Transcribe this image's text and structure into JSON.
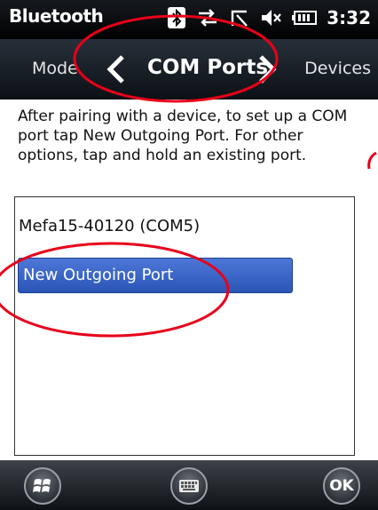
{
  "statusbar": {
    "app_title": "Bluetooth",
    "time": "3:32",
    "icons": [
      "bluetooth-icon",
      "sync-arrows-icon",
      "signal-off-icon",
      "volume-mute-icon",
      "battery-icon"
    ]
  },
  "navbar": {
    "prev_label": "Mode",
    "current_label": "COM Ports",
    "next_label": "Devices"
  },
  "instructions": "After pairing with a device, to set up a COM port tap New Outgoing Port. For other options, tap and hold an existing port.",
  "ports": {
    "items": [
      {
        "label": "Mefa15-40120 (COM5)",
        "selected": false
      },
      {
        "label": "New Outgoing Port",
        "selected": true
      }
    ]
  },
  "taskbar": {
    "start_icon": "windows-logo-icon",
    "keyboard_icon": "keyboard-icon",
    "ok_label": "OK"
  },
  "colors": {
    "accent": "#3561c5",
    "annotation": "#e8001a"
  }
}
